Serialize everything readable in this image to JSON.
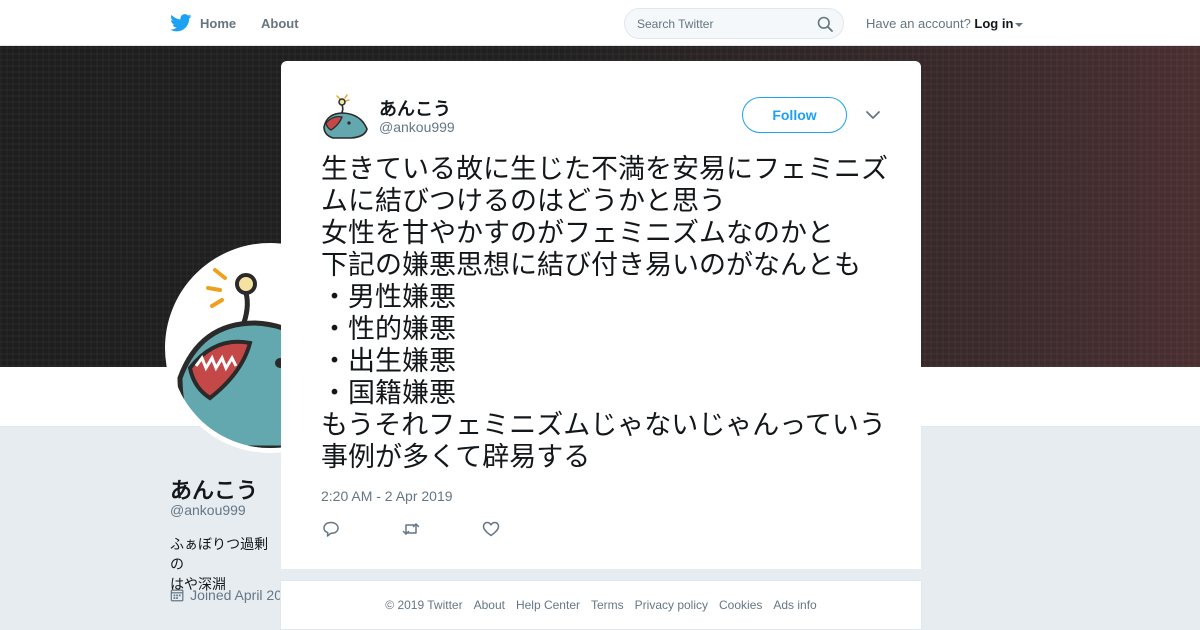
{
  "topbar": {
    "home_label": "Home",
    "about_label": "About",
    "search_placeholder": "Search Twitter",
    "account_prompt": "Have an account?",
    "login_label": "Log in"
  },
  "profile": {
    "name": "あんこう",
    "handle": "@ankou999",
    "bio_visible": "ふぁぼりつ過剰の\nはや深淵",
    "joined_visible": "Joined April 20"
  },
  "tweet": {
    "author_name": "あんこう",
    "author_handle": "@ankou999",
    "follow_label": "Follow",
    "text": "生きている故に生じた不満を安易にフェミニズムに結びつけるのはどうかと思う\n女性を甘やかすのがフェミニズムなのかと\n下記の嫌悪思想に結び付き易いのがなんとも\n・男性嫌悪\n・性的嫌悪\n・出生嫌悪\n・国籍嫌悪\nもうそれフェミニズムじゃないじゃんっていう事例が多くて辟易する",
    "timestamp": "2:20 AM - 2 Apr 2019",
    "actions": [
      "reply-icon",
      "retweet-icon",
      "like-icon"
    ]
  },
  "footer": {
    "links": [
      "© 2019 Twitter",
      "About",
      "Help Center",
      "Terms",
      "Privacy policy",
      "Cookies",
      "Ads info"
    ]
  },
  "colors": {
    "brand_blue": "#1da1f2",
    "text_primary": "#14171a",
    "text_secondary": "#657786",
    "page_bg": "#e6ecf0"
  }
}
